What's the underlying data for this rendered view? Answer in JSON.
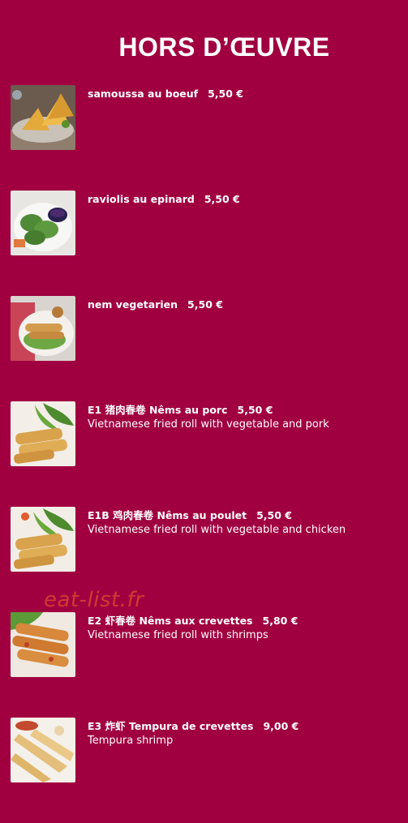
{
  "page": {
    "title": "HORS D’ŒUVRE",
    "watermark": "eat-list.fr"
  },
  "colors": {
    "background": "#a10040",
    "text": "#ffffff",
    "watermark": "#d9452f"
  },
  "items": [
    {
      "name": "samoussa au boeuf",
      "price": "5,50 €",
      "description": "",
      "image": "samosa-photo"
    },
    {
      "name": "raviolis au epinard",
      "price": "5,50 €",
      "description": "",
      "image": "spinach-dumplings-photo"
    },
    {
      "name": "nem vegetarien",
      "price": "5,50 €",
      "description": "",
      "image": "vegetarian-roll-photo"
    },
    {
      "name": "E1 猪肉春卷 Nêms au porc",
      "price": "5,50 €",
      "description": "Vietnamese fried roll with vegetable and pork",
      "image": "pork-nem-photo"
    },
    {
      "name": "E1B 鸡肉春卷 Nêms au poulet",
      "price": "5,50 €",
      "description": "Vietnamese fried roll with vegetable and chicken",
      "image": "chicken-nem-photo"
    },
    {
      "name": "E2 虾春卷 Nêms aux crevettes",
      "price": "5,80 €",
      "description": "Vietnamese fried roll with shrimps",
      "image": "shrimp-nem-photo"
    },
    {
      "name": "E3 炸虾 Tempura de crevettes",
      "price": "9,00 €",
      "description": "Tempura shrimp",
      "image": "shrimp-tempura-photo"
    }
  ]
}
